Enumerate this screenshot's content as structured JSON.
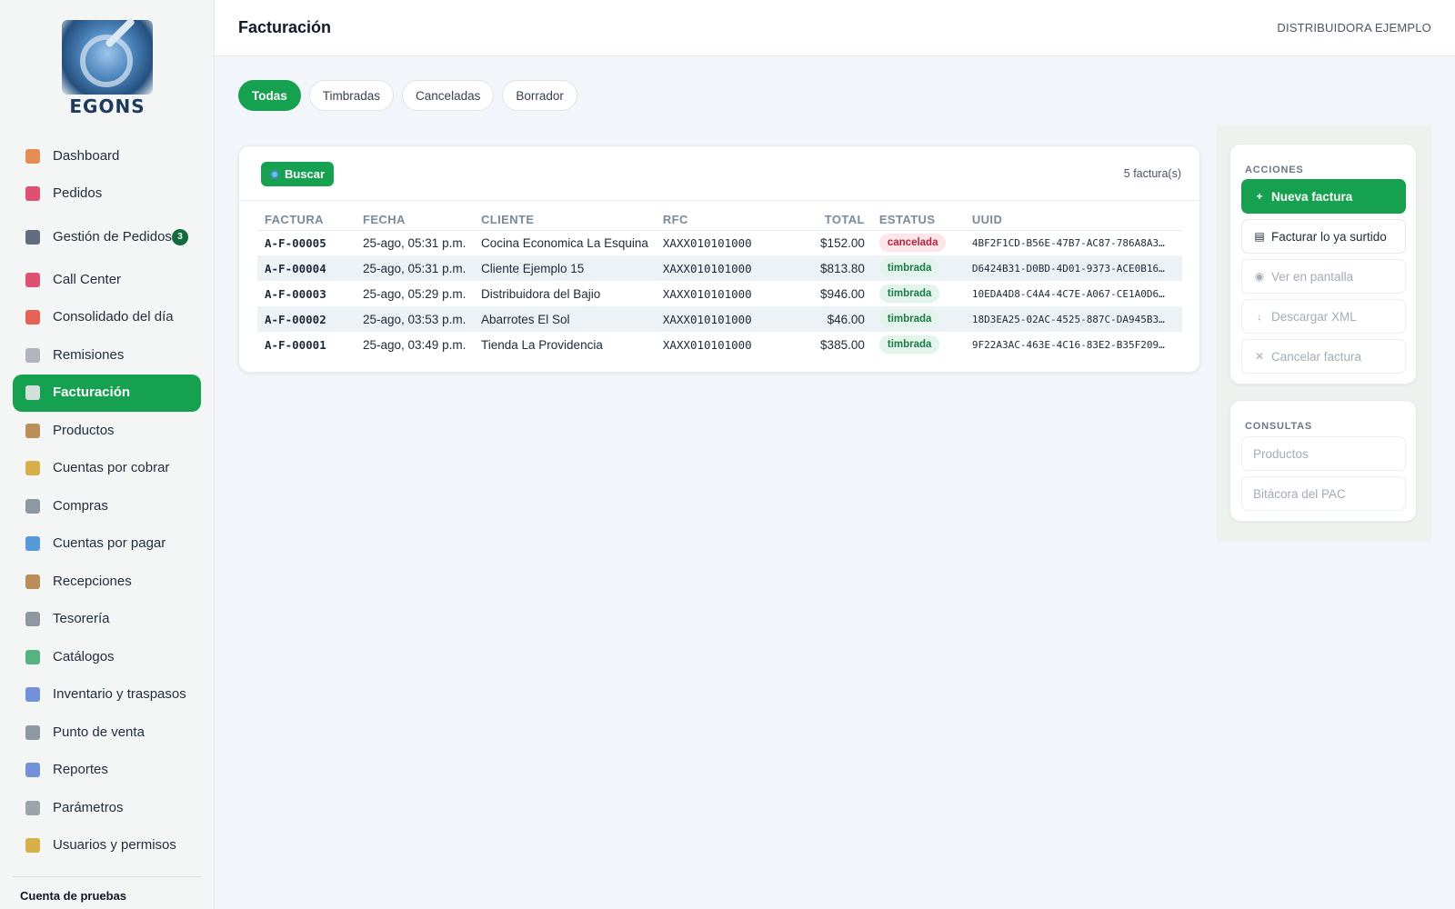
{
  "app": {
    "logo_text": "EGONS",
    "page_title": "Facturación",
    "company": "DISTRIBUIDORA EJEMPLO"
  },
  "sidebar": {
    "items": [
      {
        "label": "Dashboard",
        "icon": "chart-icon",
        "color": "#e07b39"
      },
      {
        "label": "Pedidos",
        "icon": "phone-icon",
        "color": "#d9345a"
      },
      {
        "label": "Gestión de Pedidos",
        "icon": "truck-icon",
        "badge": "3",
        "color": "#475569"
      },
      {
        "label": "Call Center",
        "icon": "telephone-icon",
        "color": "#d9345a"
      },
      {
        "label": "Consolidado del día",
        "icon": "calendar-icon",
        "color": "#e0493a"
      },
      {
        "label": "Remisiones",
        "icon": "document-icon",
        "color": "#a3a8b4"
      },
      {
        "label": "Facturación",
        "icon": "receipt-icon",
        "color": "#e5e7eb",
        "active": true
      },
      {
        "label": "Productos",
        "icon": "box-icon",
        "color": "#b07a3c"
      },
      {
        "label": "Cuentas por cobrar",
        "icon": "money-bag-icon",
        "color": "#d4a22a"
      },
      {
        "label": "Compras",
        "icon": "cart-icon",
        "color": "#7b8794"
      },
      {
        "label": "Cuentas por pagar",
        "icon": "credit-card-icon",
        "color": "#3a8ad4"
      },
      {
        "label": "Recepciones",
        "icon": "package-icon",
        "color": "#b07a3c"
      },
      {
        "label": "Tesorería",
        "icon": "bank-icon",
        "color": "#7b8794"
      },
      {
        "label": "Catálogos",
        "icon": "books-icon",
        "color": "#3aa66b"
      },
      {
        "label": "Inventario y traspasos",
        "icon": "building-icon",
        "color": "#5a7fd4"
      },
      {
        "label": "Punto de venta",
        "icon": "cart-icon",
        "color": "#7b8794"
      },
      {
        "label": "Reportes",
        "icon": "line-chart-icon",
        "color": "#5a7fd4"
      },
      {
        "label": "Parámetros",
        "icon": "gear-icon",
        "color": "#8b949e"
      },
      {
        "label": "Usuarios y permisos",
        "icon": "lock-icon",
        "color": "#d4a22a"
      }
    ],
    "account": "Cuenta de pruebas"
  },
  "tabs": [
    {
      "label": "Todas",
      "active": true
    },
    {
      "label": "Timbradas"
    },
    {
      "label": "Canceladas"
    },
    {
      "label": "Borrador"
    }
  ],
  "toolbar": {
    "search_label": "Buscar",
    "count": "5 factura(s)"
  },
  "table": {
    "columns": [
      "FACTURA",
      "FECHA",
      "CLIENTE",
      "RFC",
      "TOTAL",
      "ESTATUS",
      "UUID"
    ],
    "rows": [
      {
        "factura": "A-F-00005",
        "fecha": "25-ago, 05:31 p.m.",
        "cliente": "Cocina Economica La Esquina",
        "rfc": "XAXX010101000",
        "total": "$152.00",
        "estatus": "cancelada",
        "uuid": "4BF2F1CD-B56E-47B7-AC87-786A8A3…"
      },
      {
        "factura": "A-F-00004",
        "fecha": "25-ago, 05:31 p.m.",
        "cliente": "Cliente Ejemplo 15",
        "rfc": "XAXX010101000",
        "total": "$813.80",
        "estatus": "timbrada",
        "uuid": "D6424B31-D0BD-4D01-9373-ACE0B16…"
      },
      {
        "factura": "A-F-00003",
        "fecha": "25-ago, 05:29 p.m.",
        "cliente": "Distribuidora del Bajio",
        "rfc": "XAXX010101000",
        "total": "$946.00",
        "estatus": "timbrada",
        "uuid": "10EDA4D8-C4A4-4C7E-A067-CE1A0D6…"
      },
      {
        "factura": "A-F-00002",
        "fecha": "25-ago, 03:53 p.m.",
        "cliente": "Abarrotes El Sol",
        "rfc": "XAXX010101000",
        "total": "$46.00",
        "estatus": "timbrada",
        "uuid": "18D3EA25-02AC-4525-887C-DA945B3…"
      },
      {
        "factura": "A-F-00001",
        "fecha": "25-ago, 03:49 p.m.",
        "cliente": "Tienda La Providencia",
        "rfc": "XAXX010101000",
        "total": "$385.00",
        "estatus": "timbrada",
        "uuid": "9F22A3AC-463E-4C16-83E2-B35F209…"
      }
    ]
  },
  "acciones": {
    "title": "ACCIONES",
    "buttons": [
      {
        "label": "Nueva factura",
        "glyph": "+",
        "icon": "plus-icon",
        "state": "primary"
      },
      {
        "label": "Facturar lo ya surtido",
        "glyph": "▤",
        "icon": "document-icon",
        "state": "normal"
      },
      {
        "label": "Ver en pantalla",
        "glyph": "◉",
        "icon": "eye-icon",
        "state": "disabled"
      },
      {
        "label": "Descargar XML",
        "glyph": "↓",
        "icon": "download-icon",
        "state": "disabled"
      },
      {
        "label": "Cancelar factura",
        "glyph": "✕",
        "icon": "close-icon",
        "state": "disabled"
      }
    ]
  },
  "consultas": {
    "title": "CONSULTAS",
    "buttons": [
      {
        "label": "Productos",
        "state": "disabled"
      },
      {
        "label": "Bitácora del PAC",
        "state": "disabled"
      }
    ]
  },
  "colors": {
    "accent": "#16a150",
    "cancelada_bg": "#fde6ea",
    "timbrada_bg": "#e3f4ea"
  }
}
